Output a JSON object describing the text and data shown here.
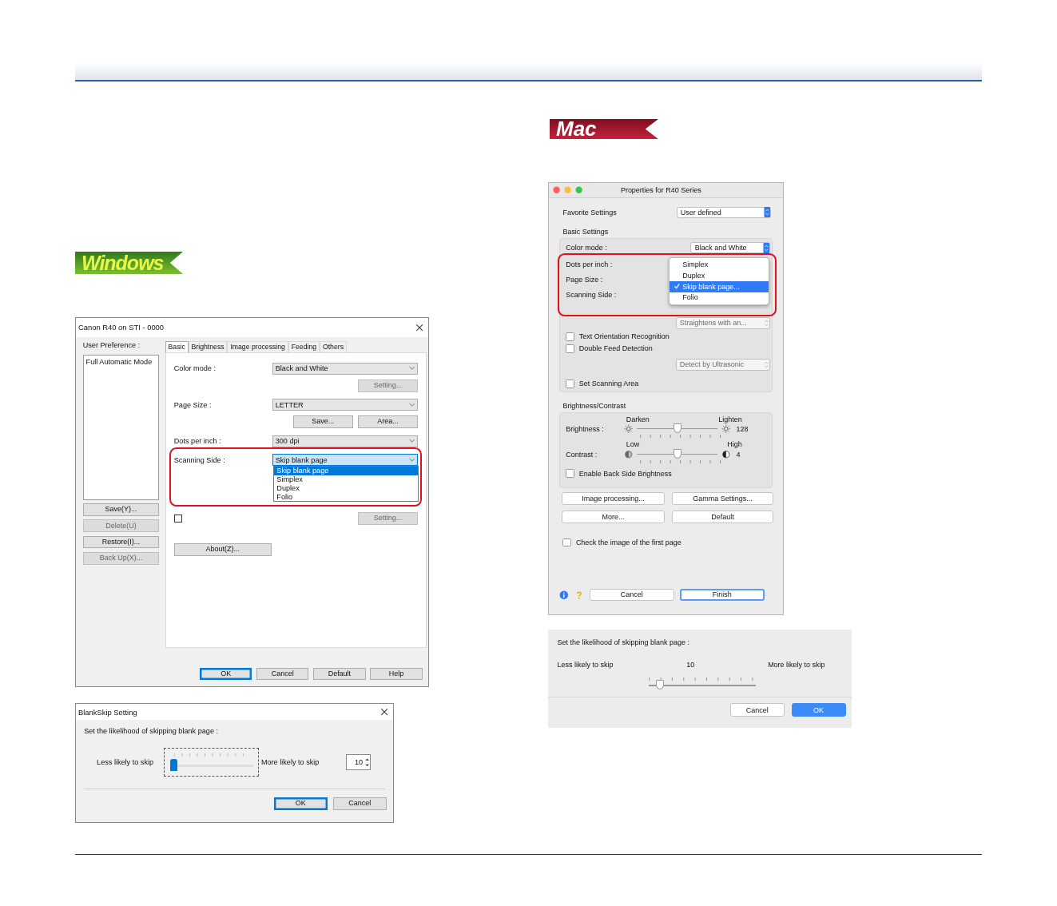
{
  "windows": {
    "logo": "Windows",
    "properties_dialog": {
      "title": "Canon R40 on STI - 0000",
      "preference_label": "User Preference :",
      "preferences": [
        {
          "label": "Full Automatic Mode",
          "selected": false
        }
      ],
      "preference_buttons": [
        {
          "label": "Save(Y)...",
          "disabled": false
        },
        {
          "label": "Delete(U)",
          "disabled": true
        },
        {
          "label": "Restore(I)...",
          "disabled": false
        },
        {
          "label": "Back Up(X)...",
          "disabled": true
        }
      ],
      "tabs": [
        {
          "label": "Basic",
          "selected": true
        },
        {
          "label": "Brightness",
          "selected": false
        },
        {
          "label": "Image processing",
          "selected": false
        },
        {
          "label": "Feeding",
          "selected": false
        },
        {
          "label": "Others",
          "selected": false
        }
      ],
      "fields": [
        {
          "label": "Color mode :",
          "value": "Black and White",
          "buttons": [
            {
              "label": "Setting...",
              "disabled": true
            }
          ]
        },
        {
          "label": "Page Size :",
          "value": "LETTER",
          "buttons": [
            {
              "label": "Save...",
              "disabled": false
            },
            {
              "label": "Area...",
              "disabled": false
            }
          ]
        },
        {
          "label": "Dots per inch :",
          "value": "300 dpi"
        },
        {
          "label": "Scanning Side :",
          "value": "Skip blank page",
          "highlighted": true,
          "options": [
            {
              "label": "Skip blank page",
              "selected": true
            },
            {
              "label": "Simplex",
              "selected": false
            },
            {
              "label": "Duplex",
              "selected": false
            },
            {
              "label": "Folio",
              "selected": false
            }
          ]
        }
      ],
      "skew_checkbox": {
        "checked": false
      },
      "skew_button": {
        "label": "Setting...",
        "disabled": true
      },
      "about_button": "About(Z)...",
      "buttons": [
        "OK",
        "Cancel",
        "Default",
        "Help"
      ]
    },
    "blankskip_dialog": {
      "title": "BlankSkip Setting",
      "prompt": "Set the likelihood of skipping blank page :",
      "min_label": "Less likely to skip",
      "max_label": "More likely to skip",
      "level": 0.1,
      "value": "10",
      "buttons": [
        "OK",
        "Cancel"
      ]
    }
  },
  "mac": {
    "logo": "Mac",
    "properties_dialog": {
      "title": "Properties for R40 Series",
      "favorite_label": "Favorite Settings",
      "favorite_value": "User defined",
      "basic_heading": "Basic Settings",
      "color_mode": {
        "label": "Color mode :",
        "value": "Black and White"
      },
      "side_labels": [
        "Dots per inch :",
        "Page Size :",
        "Scanning Side :"
      ],
      "side_options": [
        {
          "label": "Simplex",
          "selected": false
        },
        {
          "label": "Duplex",
          "selected": false
        },
        {
          "label": "Skip blank page...",
          "selected": true
        },
        {
          "label": "Folio",
          "selected": false
        }
      ],
      "items": [
        {
          "kind": "select",
          "value": "Straightens with an...",
          "disabled": true
        },
        {
          "kind": "checkbox",
          "label": "Text Orientation Recognition",
          "checked": false
        },
        {
          "kind": "checkbox",
          "label": "Double Feed Detection",
          "checked": false
        },
        {
          "kind": "select",
          "value": "Detect by Ultrasonic",
          "disabled": true
        },
        {
          "kind": "checkbox",
          "label": "Set Scanning Area",
          "checked": false
        }
      ],
      "brightness_heading": "Brightness/Contrast",
      "sliders": [
        {
          "kind": "sun",
          "label": "Brightness :",
          "min_label": "Darken",
          "max_label": "Lighten",
          "value": "128",
          "level": 0.5
        },
        {
          "kind": "contrast",
          "label": "Contrast :",
          "min_label": "Low",
          "max_label": "High",
          "value": "4",
          "level": 0.5
        }
      ],
      "back_side_checkbox": {
        "label": "Enable Back Side Brightness",
        "checked": false
      },
      "buttons": [
        "Image processing...",
        "Gamma Settings...",
        "More...",
        "Default"
      ],
      "first_page_checkbox": {
        "label": "Check the image of the first page",
        "checked": false
      },
      "footer_buttons": [
        {
          "label": "Cancel",
          "default": false
        },
        {
          "label": "Finish",
          "default": true
        }
      ]
    },
    "blankskip_dialog": {
      "prompt": "Set the likelihood of skipping blank page :",
      "min_label": "Less likely to skip",
      "value": "10",
      "max_label": "More likely to skip",
      "level": 0.1,
      "buttons": [
        {
          "label": "Cancel",
          "default": false
        },
        {
          "label": "OK",
          "default": true
        }
      ]
    }
  }
}
